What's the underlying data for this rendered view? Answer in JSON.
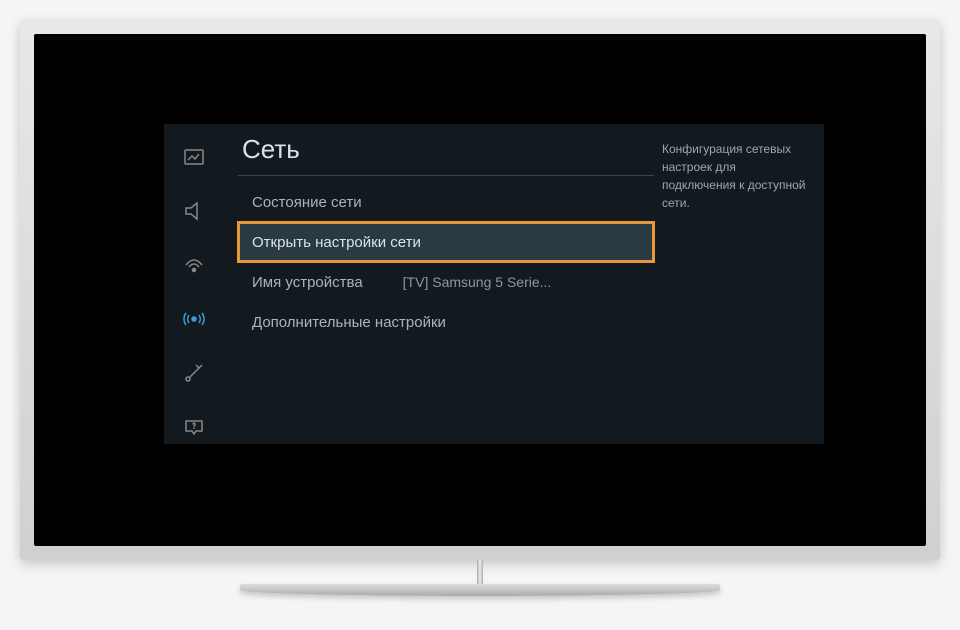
{
  "panel": {
    "title": "Сеть",
    "description": "Конфигурация сетевых настроек для подключения к доступной сети."
  },
  "sidebar": {
    "items": [
      {
        "name": "picture",
        "active": false
      },
      {
        "name": "sound",
        "active": false
      },
      {
        "name": "broadcasting",
        "active": false
      },
      {
        "name": "network",
        "active": true
      },
      {
        "name": "system",
        "active": false
      },
      {
        "name": "support",
        "active": false
      }
    ]
  },
  "menu": {
    "items": [
      {
        "label": "Состояние сети",
        "value": "",
        "highlighted": false
      },
      {
        "label": "Открыть настройки сети",
        "value": "",
        "highlighted": true
      },
      {
        "label": "Имя устройства",
        "value": "[TV] Samsung 5 Serie...",
        "highlighted": false
      },
      {
        "label": "Дополнительные настройки",
        "value": "",
        "highlighted": false
      }
    ]
  }
}
